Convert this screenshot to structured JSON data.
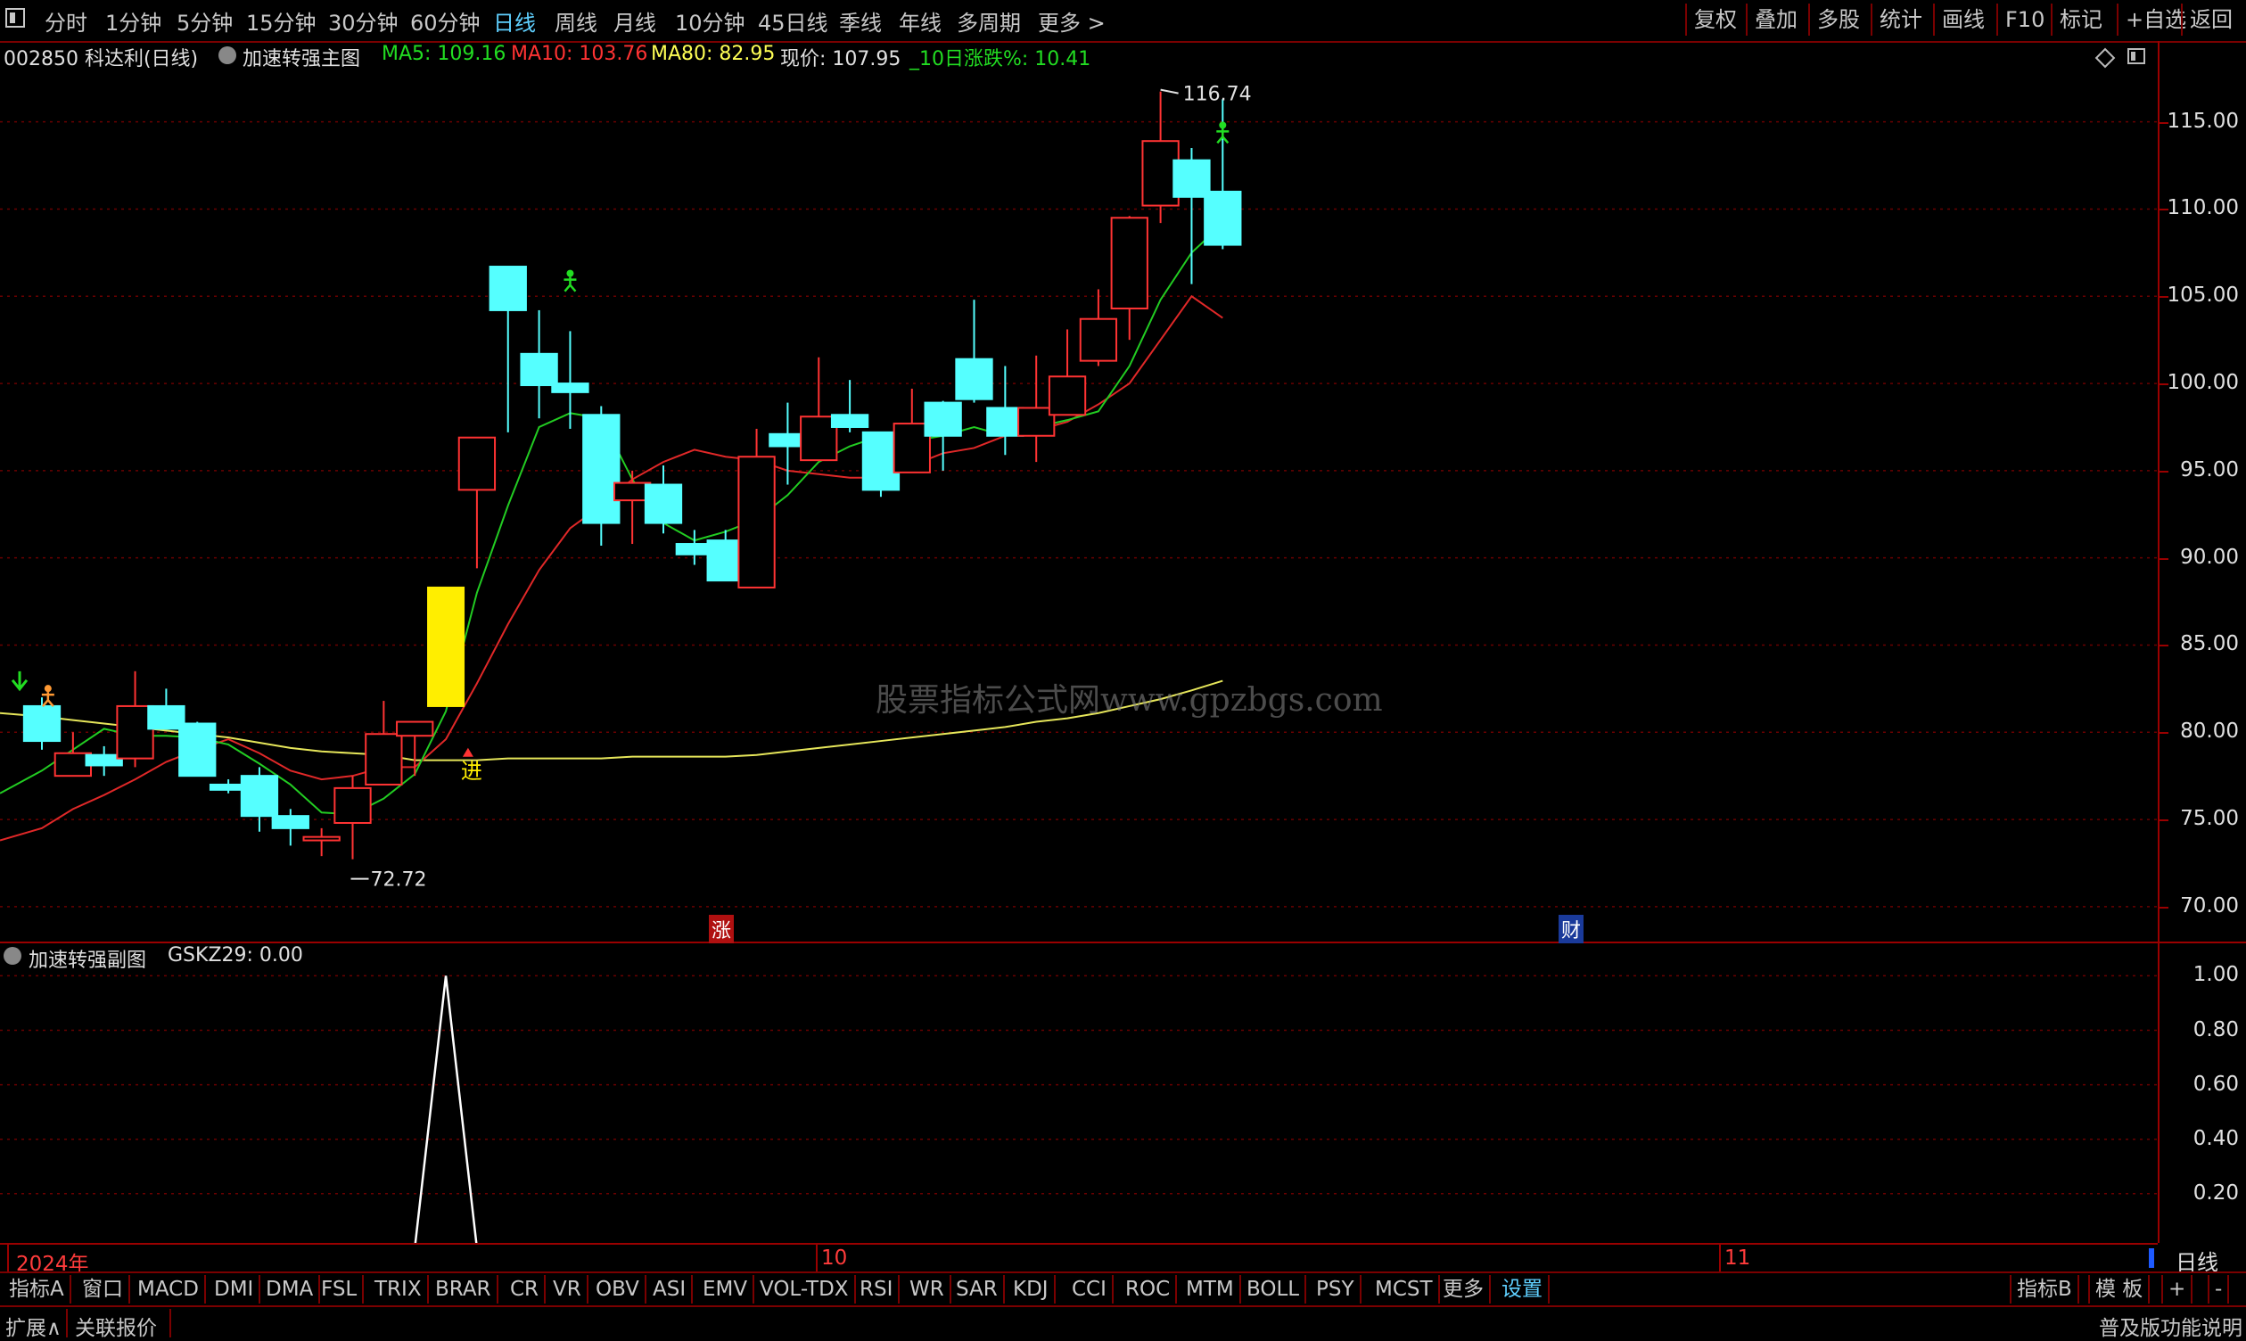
{
  "toolbar": {
    "left_icon": "window-icon",
    "periods": [
      "分时",
      "1分钟",
      "5分钟",
      "15分钟",
      "30分钟",
      "60分钟",
      "日线",
      "周线",
      "月线",
      "10分钟",
      "45日线",
      "季线",
      "年线",
      "多周期",
      "更多 >"
    ],
    "active_period": "日线",
    "right_buttons": [
      "复权",
      "叠加",
      "多股",
      "统计",
      "画线",
      "F10",
      "标记",
      "+自选",
      "返回"
    ]
  },
  "info": {
    "stock": "002850 科达利(日线)",
    "indicator_main": "加速转强主图",
    "ma5": "MA5: 109.16",
    "ma10": "MA10: 103.76",
    "ma80": "MA80: 82.95",
    "price": "现价: 107.95",
    "change10": "_10日涨跌%: 10.41",
    "colors": {
      "ma5": "#22dd22",
      "ma10": "#ff3333",
      "ma80": "#ffff55",
      "price": "#e0e0e0",
      "change10": "#22dd22"
    }
  },
  "main_axis": {
    "ticks": [
      "115.00",
      "110.00",
      "105.00",
      "100.00",
      "95.00",
      "90.00",
      "85.00",
      "80.00",
      "75.00",
      "70.00"
    ]
  },
  "annotations": {
    "high": "116.74",
    "low": "72.72",
    "enter": "进",
    "zhang": "涨",
    "cai": "财",
    "watermark": "股票指标公式网www.gpzbgs.com"
  },
  "sub_chart": {
    "title": "加速转强副图",
    "value": "GSKZ29: 0.00",
    "ticks": [
      "1.00",
      "0.80",
      "0.60",
      "0.40",
      "0.20"
    ]
  },
  "x_axis": {
    "year": "2024年",
    "m10": "10",
    "m11": "11",
    "period_label": "日线"
  },
  "tabs": [
    "指标A",
    "窗口",
    "MACD",
    "DMI",
    "DMA",
    "FSL",
    "TRIX",
    "BRAR",
    "CR",
    "VR",
    "OBV",
    "ASI",
    "EMV",
    "VOL-TDX",
    "RSI",
    "WR",
    "SAR",
    "KDJ",
    "CCI",
    "ROC",
    "MTM",
    "BOLL",
    "PSY",
    "MCST",
    "更多",
    "设置"
  ],
  "active_tab": "设置",
  "tabs_right": [
    "指标B",
    "模 板",
    "+",
    "-"
  ],
  "status": {
    "left1": "扩展∧",
    "left2": "关联报价",
    "right": "普及版功能说明"
  },
  "chart_data": {
    "type": "candlestick",
    "ylim": [
      68,
      118
    ],
    "candles": [
      {
        "o": 79.5,
        "c": 81.5,
        "h": 82.0,
        "l": 79.0,
        "up": false
      },
      {
        "o": 78.8,
        "c": 77.5,
        "h": 80.0,
        "l": 77.5,
        "up": true
      },
      {
        "o": 78.7,
        "c": 78.1,
        "h": 79.2,
        "l": 77.5,
        "up": false
      },
      {
        "o": 78.5,
        "c": 81.5,
        "h": 83.5,
        "l": 78.0,
        "up": true
      },
      {
        "o": 81.5,
        "c": 80.2,
        "h": 82.5,
        "l": 80.2,
        "up": false
      },
      {
        "o": 80.5,
        "c": 77.5,
        "h": 80.6,
        "l": 77.5,
        "up": false
      },
      {
        "o": 77.0,
        "c": 76.7,
        "h": 77.3,
        "l": 76.5,
        "up": false
      },
      {
        "o": 77.5,
        "c": 75.2,
        "h": 78.0,
        "l": 74.3,
        "up": false
      },
      {
        "o": 75.2,
        "c": 74.5,
        "h": 75.6,
        "l": 73.5,
        "up": false
      },
      {
        "o": 73.8,
        "c": 74.0,
        "h": 74.5,
        "l": 72.9,
        "up": true
      },
      {
        "o": 74.8,
        "c": 76.8,
        "h": 77.5,
        "l": 72.72,
        "up": true
      },
      {
        "o": 77.0,
        "c": 79.9,
        "h": 81.8,
        "l": 77.0,
        "up": true
      },
      {
        "o": 79.8,
        "c": 80.6,
        "h": 80.6,
        "l": 77.5,
        "up": true
      },
      {
        "o": 81.5,
        "c": 88.3,
        "h": 88.3,
        "l": 81.5,
        "up": false,
        "special": "yellow"
      },
      {
        "o": 93.9,
        "c": 96.9,
        "h": 96.9,
        "l": 89.4,
        "up": true
      },
      {
        "o": 106.7,
        "c": 104.2,
        "h": 106.7,
        "l": 97.2,
        "up": false
      },
      {
        "o": 101.7,
        "c": 99.9,
        "h": 104.2,
        "l": 98.0,
        "up": false
      },
      {
        "o": 100.0,
        "c": 99.5,
        "h": 103.0,
        "l": 97.4,
        "up": false
      },
      {
        "o": 98.2,
        "c": 92.0,
        "h": 98.7,
        "l": 90.7,
        "up": false
      },
      {
        "o": 93.3,
        "c": 94.3,
        "h": 95.0,
        "l": 90.8,
        "up": true
      },
      {
        "o": 94.2,
        "c": 92.0,
        "h": 95.3,
        "l": 91.4,
        "up": false
      },
      {
        "o": 90.8,
        "c": 90.2,
        "h": 91.6,
        "l": 89.6,
        "up": false
      },
      {
        "o": 91.0,
        "c": 88.7,
        "h": 91.6,
        "l": 88.7,
        "up": false
      },
      {
        "o": 88.3,
        "c": 95.8,
        "h": 97.4,
        "l": 88.3,
        "up": true
      },
      {
        "o": 96.4,
        "c": 97.1,
        "h": 98.9,
        "l": 94.2,
        "up": false
      },
      {
        "o": 95.6,
        "c": 98.1,
        "h": 101.5,
        "l": 95.6,
        "up": true
      },
      {
        "o": 98.2,
        "c": 97.5,
        "h": 100.2,
        "l": 97.2,
        "up": false
      },
      {
        "o": 97.2,
        "c": 93.9,
        "h": 97.2,
        "l": 93.5,
        "up": false
      },
      {
        "o": 94.9,
        "c": 97.7,
        "h": 99.7,
        "l": 94.9,
        "up": true
      },
      {
        "o": 98.9,
        "c": 97.0,
        "h": 99.0,
        "l": 95.0,
        "up": false
      },
      {
        "o": 101.4,
        "c": 99.1,
        "h": 104.8,
        "l": 98.9,
        "up": false
      },
      {
        "o": 98.6,
        "c": 97.0,
        "h": 101.0,
        "l": 95.9,
        "up": false
      },
      {
        "o": 97.0,
        "c": 98.6,
        "h": 101.6,
        "l": 95.5,
        "up": true
      },
      {
        "o": 98.2,
        "c": 100.4,
        "h": 103.1,
        "l": 98.2,
        "up": true
      },
      {
        "o": 101.3,
        "c": 103.7,
        "h": 105.4,
        "l": 101.0,
        "up": true
      },
      {
        "o": 104.3,
        "c": 109.5,
        "h": 109.6,
        "l": 102.5,
        "up": true
      },
      {
        "o": 110.2,
        "c": 113.9,
        "h": 116.74,
        "l": 109.2,
        "up": true
      },
      {
        "o": 112.8,
        "c": 110.7,
        "h": 113.5,
        "l": 105.7,
        "up": false
      },
      {
        "o": 111.0,
        "c": 107.95,
        "h": 116.3,
        "l": 107.7,
        "up": false
      }
    ],
    "ma5": [
      77.8,
      79.0,
      80.2,
      79.8,
      79.8,
      79.7,
      79.3,
      78.2,
      77.0,
      75.4,
      75.3,
      76.2,
      77.6,
      81.2,
      88.0,
      93.0,
      97.5,
      98.3,
      98.0,
      94.5,
      92.0,
      91.0,
      91.5,
      92.2,
      93.6,
      95.5,
      96.4,
      97.0,
      96.7,
      97.0,
      97.5,
      97.0,
      97.5,
      97.9,
      98.4,
      101.0,
      104.8,
      107.5,
      109.16
    ],
    "ma10": [
      74.5,
      75.6,
      76.4,
      77.3,
      78.3,
      79.0,
      79.6,
      78.8,
      77.8,
      77.3,
      77.5,
      78.0,
      78.0,
      79.6,
      82.8,
      86.2,
      89.3,
      91.7,
      93.0,
      94.5,
      95.5,
      96.2,
      95.8,
      95.6,
      95.0,
      94.8,
      94.6,
      94.6,
      95.3,
      96.0,
      96.3,
      97.0,
      97.3,
      97.8,
      98.8,
      100.0,
      102.5,
      105.0,
      103.76
    ],
    "ma80": [
      80.9,
      80.7,
      80.5,
      80.3,
      80.1,
      79.9,
      79.7,
      79.4,
      79.1,
      78.9,
      78.8,
      78.7,
      78.4,
      78.4,
      78.4,
      78.5,
      78.5,
      78.5,
      78.5,
      78.6,
      78.6,
      78.6,
      78.6,
      78.7,
      78.9,
      79.1,
      79.3,
      79.5,
      79.7,
      79.9,
      80.1,
      80.3,
      80.6,
      80.8,
      81.1,
      81.5,
      81.9,
      82.4,
      82.95
    ],
    "sub_values": [
      0,
      0,
      0,
      0,
      0,
      0,
      0,
      0,
      0,
      0,
      0,
      0,
      0,
      1,
      0,
      0,
      0,
      0,
      0,
      0,
      0,
      0,
      0,
      0,
      0,
      0,
      0,
      0,
      0,
      0,
      0,
      0,
      0,
      0,
      0,
      0,
      0,
      0,
      0
    ]
  }
}
